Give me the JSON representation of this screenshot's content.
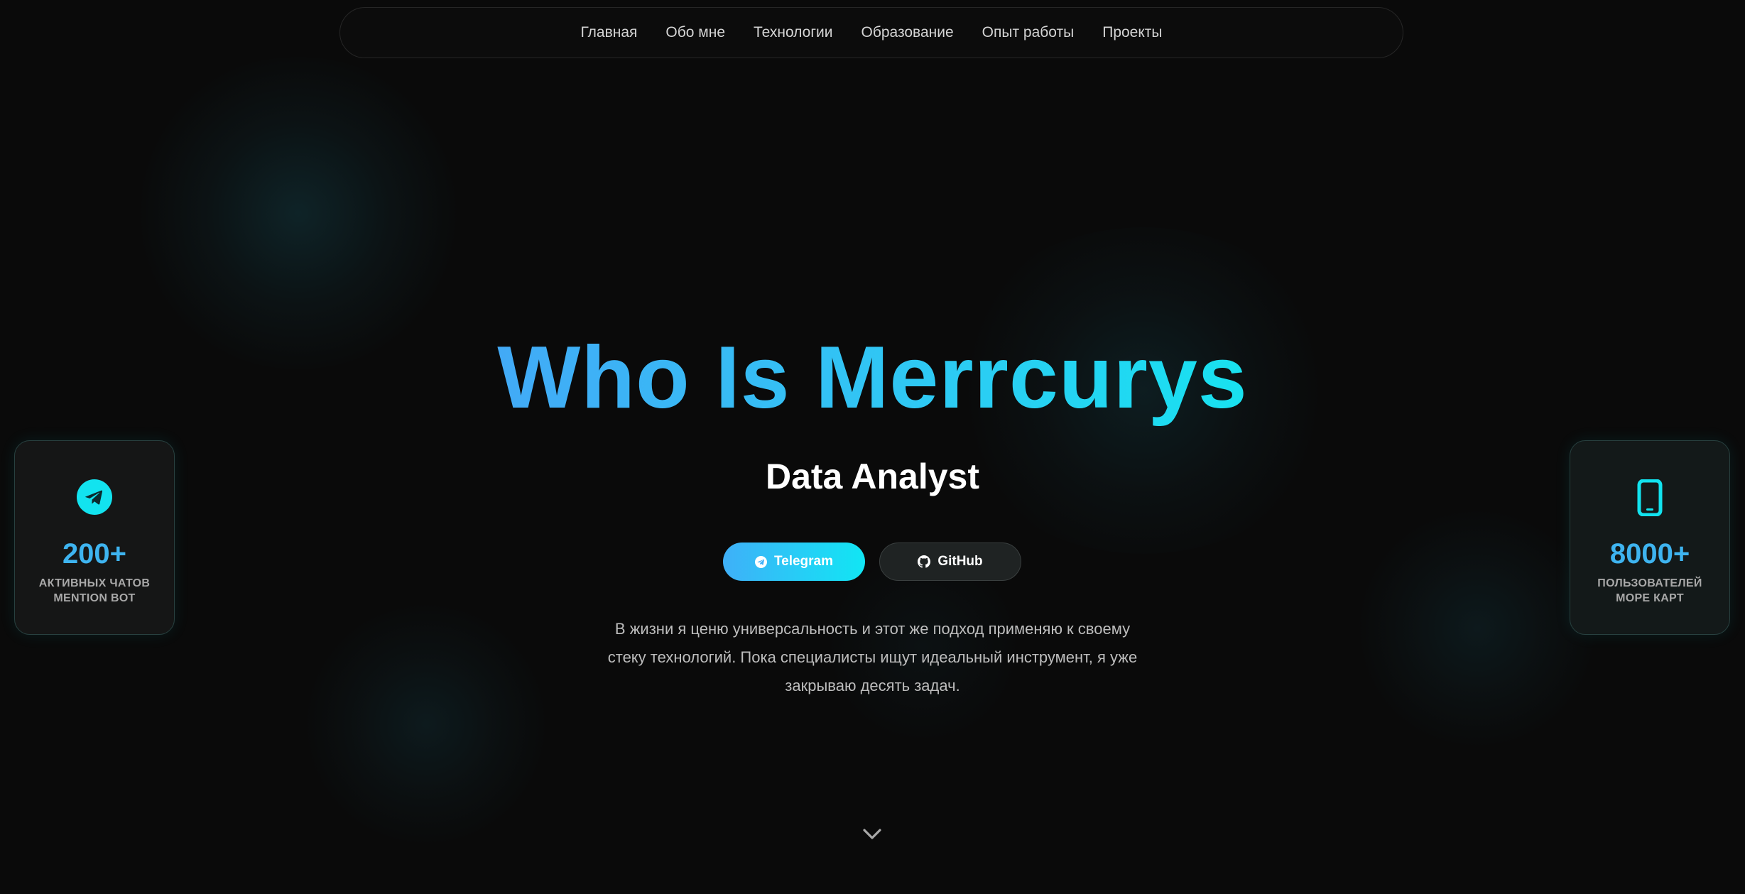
{
  "nav": {
    "items": [
      {
        "label": "Главная"
      },
      {
        "label": "Обо мне"
      },
      {
        "label": "Технологии"
      },
      {
        "label": "Образование"
      },
      {
        "label": "Опыт работы"
      },
      {
        "label": "Проекты"
      }
    ]
  },
  "hero": {
    "title": "Who Is Merrcurys",
    "subtitle": "Data Analyst",
    "buttons": {
      "telegram_label": "Telegram",
      "github_label": "GitHub"
    },
    "description": "В жизни я ценю универсальность и этот же подход применяю к своему стеку технологий. Пока специалисты ищут идеальный инструмент, я уже закрываю десять задач."
  },
  "stats": {
    "left": {
      "icon": "telegram-icon",
      "value": "200+",
      "label_line1": "активных чатов",
      "label_line2": "Mention Bot"
    },
    "right": {
      "icon": "smartphone-icon",
      "value": "8000+",
      "label_line1": "пользователей",
      "label_line2": "Море Карт"
    }
  },
  "colors": {
    "background": "#0a0a0a",
    "accent_blue": "#42aaf6",
    "accent_cyan": "#18e2f0",
    "text_primary": "#ffffff",
    "text_secondary": "#bdbdbd"
  },
  "icons": {
    "scroll": "chevron-down-icon",
    "github": "github-icon",
    "telegram": "telegram-icon"
  }
}
